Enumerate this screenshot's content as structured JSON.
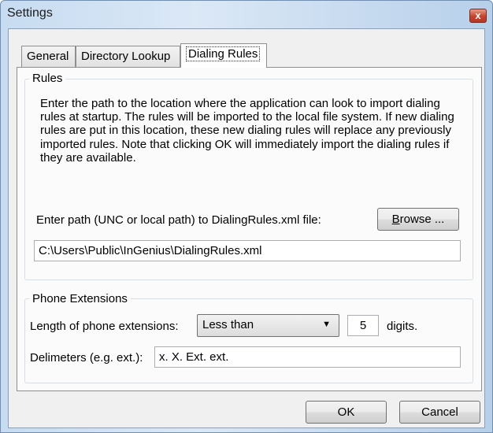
{
  "window": {
    "title": "Settings",
    "close_glyph": "x"
  },
  "tabs": [
    {
      "label": "General",
      "active": false
    },
    {
      "label": "Directory Lookup",
      "active": false
    },
    {
      "label": "Dialing Rules",
      "active": true
    }
  ],
  "rules": {
    "legend": "Rules",
    "description": "Enter the path to the location where the application can look to import dialing rules at startup.  The rules will be imported to the local file system.  If new dialing rules are put in this location, these new dialing rules will replace any previously imported rules.  Note that clicking OK will immediately import the dialing rules if they are available.",
    "path_label": "Enter path (UNC or local path) to DialingRules.xml file:",
    "browse_label": "Browse ...",
    "path_value": "C:\\Users\\Public\\InGenius\\DialingRules.xml"
  },
  "extensions": {
    "legend": "Phone Extensions",
    "length_label": "Length of phone extensions:",
    "comparison_selected": "Less than",
    "digits_value": "5",
    "digits_suffix": "digits.",
    "delimiters_label": "Delimeters (e.g. ext.):",
    "delimiters_value": "x. X. Ext. ext."
  },
  "footer": {
    "ok_label": "OK",
    "cancel_label": "Cancel"
  },
  "colors": {
    "title_bar": "#c7dcf1",
    "close_button": "#c8422c",
    "dialog_bg": "#f0f0f0"
  }
}
